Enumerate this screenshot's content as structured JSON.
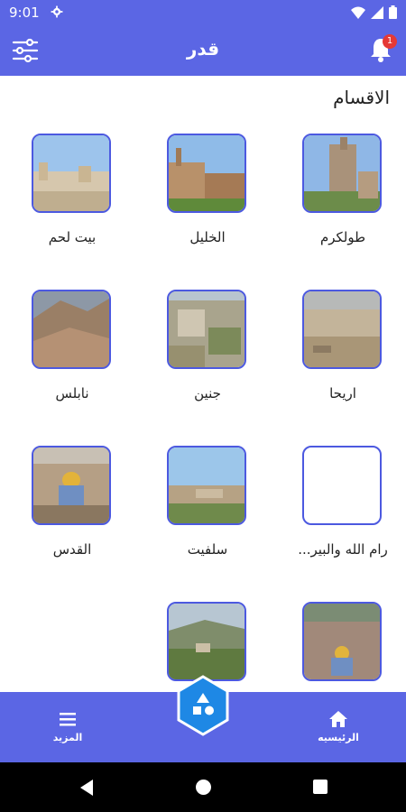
{
  "status": {
    "time": "9:01"
  },
  "header": {
    "title": "قدر",
    "notification_count": "1"
  },
  "section": {
    "title": "الاقسام"
  },
  "categories": [
    {
      "label": "طولكرم",
      "image": "tulkarm-photo"
    },
    {
      "label": "الخليل",
      "image": "hebron-photo"
    },
    {
      "label": "بيت لحم",
      "image": "bethlehem-photo"
    },
    {
      "label": "اريحا",
      "image": "jericho-photo"
    },
    {
      "label": "جنين",
      "image": "jenin-photo"
    },
    {
      "label": "نابلس",
      "image": "nablus-photo"
    },
    {
      "label": "رام الله والبير...",
      "image": ""
    },
    {
      "label": "سلفيت",
      "image": "salfit-photo"
    },
    {
      "label": "القدس",
      "image": "jerusalem-photo"
    },
    {
      "label": "",
      "image": "city-photo"
    },
    {
      "label": "",
      "image": "valley-photo"
    }
  ],
  "bottom_nav": {
    "home_label": "الرئيسيه",
    "more_label": "المزيد"
  },
  "colors": {
    "primary": "#5b66e4",
    "accent": "#4c59e0",
    "fab": "#1e88e5"
  }
}
